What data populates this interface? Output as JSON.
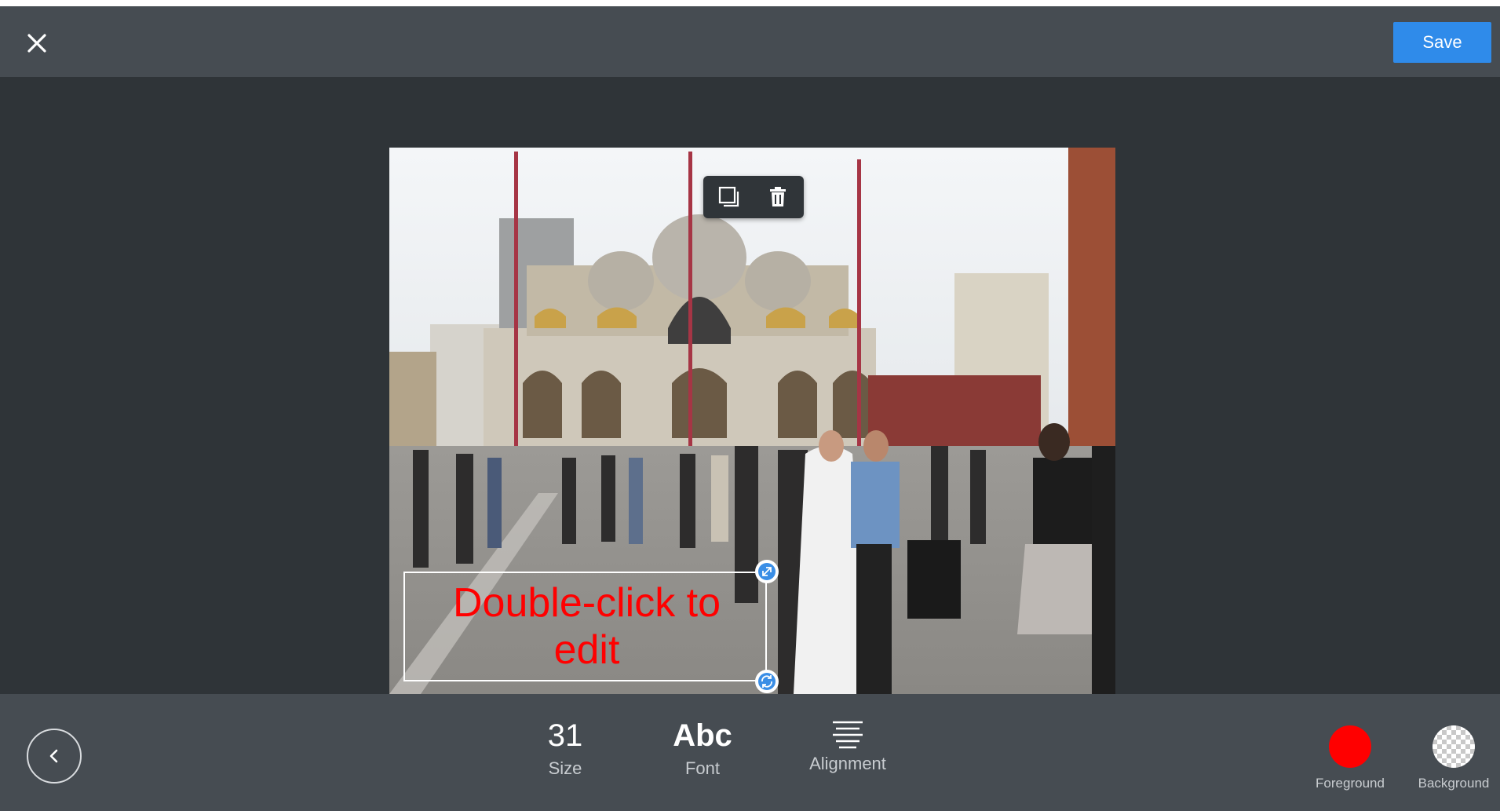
{
  "toolbar": {
    "save_label": "Save"
  },
  "canvas": {
    "text_line_1": "Double-click to",
    "text_line_2": "edit"
  },
  "bottom": {
    "size_value": "31",
    "size_label": "Size",
    "font_value": "Abc",
    "font_label": "Font",
    "alignment_label": "Alignment",
    "foreground_label": "Foreground",
    "background_label": "Background"
  },
  "colors": {
    "foreground": "#ff0000",
    "background": "transparent",
    "accent": "#2f8bea",
    "topbar": "#464c52",
    "workspace": "#2f3438"
  },
  "icons": [
    "close-icon",
    "duplicate-icon",
    "trash-icon",
    "resize-handle-icon",
    "rotate-handle-icon",
    "chevron-left-icon",
    "align-center-icon"
  ]
}
